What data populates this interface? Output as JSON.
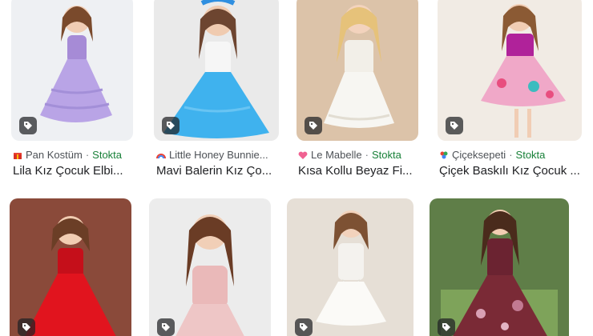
{
  "results": [
    {
      "source": "Pan Kostüm",
      "stock": "Stokta",
      "title": "Lila Kız Çocuk Elbi...",
      "icon": "gift-favicon",
      "colors": {
        "bg": "#eef0f3",
        "dress": "#b9a4e6",
        "top": "#a68bd6"
      }
    },
    {
      "source": "Little Honey Bunnie...",
      "stock": "",
      "title": "Mavi Balerin Kız Ço...",
      "icon": "rainbow-favicon",
      "colors": {
        "bg": "#eaeaea",
        "dress": "#3fb2ee",
        "top": "#ffffff"
      }
    },
    {
      "source": "Le Mabelle",
      "stock": "Stokta",
      "title": "Kısa Kollu Beyaz Fi...",
      "icon": "heart-favicon",
      "colors": {
        "bg": "#dcc3a9",
        "dress": "#f7f6f2",
        "top": "#f2efe8"
      }
    },
    {
      "source": "Çiçeksepeti",
      "stock": "Stokta",
      "title": "Çiçek Baskılı Kız Çocuk ...",
      "icon": "flower-favicon",
      "colors": {
        "bg": "#f1ebe4",
        "dress": "#f0a8c8",
        "top": "#b0229a"
      }
    },
    {
      "source": "",
      "stock": "",
      "title": "",
      "icon": "",
      "colors": {
        "bg": "#8a4a3a",
        "dress": "#e1141e",
        "top": "#c50f1a"
      }
    },
    {
      "source": "",
      "stock": "",
      "title": "",
      "icon": "",
      "colors": {
        "bg": "#ececec",
        "dress": "#eec6c6",
        "top": "#eab9b9"
      }
    },
    {
      "source": "",
      "stock": "",
      "title": "",
      "icon": "",
      "colors": {
        "bg": "#e6dfd6",
        "dress": "#fbfaf7",
        "top": "#f4f2ee"
      }
    },
    {
      "source": "",
      "stock": "",
      "title": "",
      "icon": "",
      "colors": {
        "bg": "#5f7e48",
        "dress": "#7a2a36",
        "top": "#6b2331"
      }
    }
  ],
  "separator": "·",
  "colors": {
    "stock": "#188038",
    "badge": "#202124"
  }
}
